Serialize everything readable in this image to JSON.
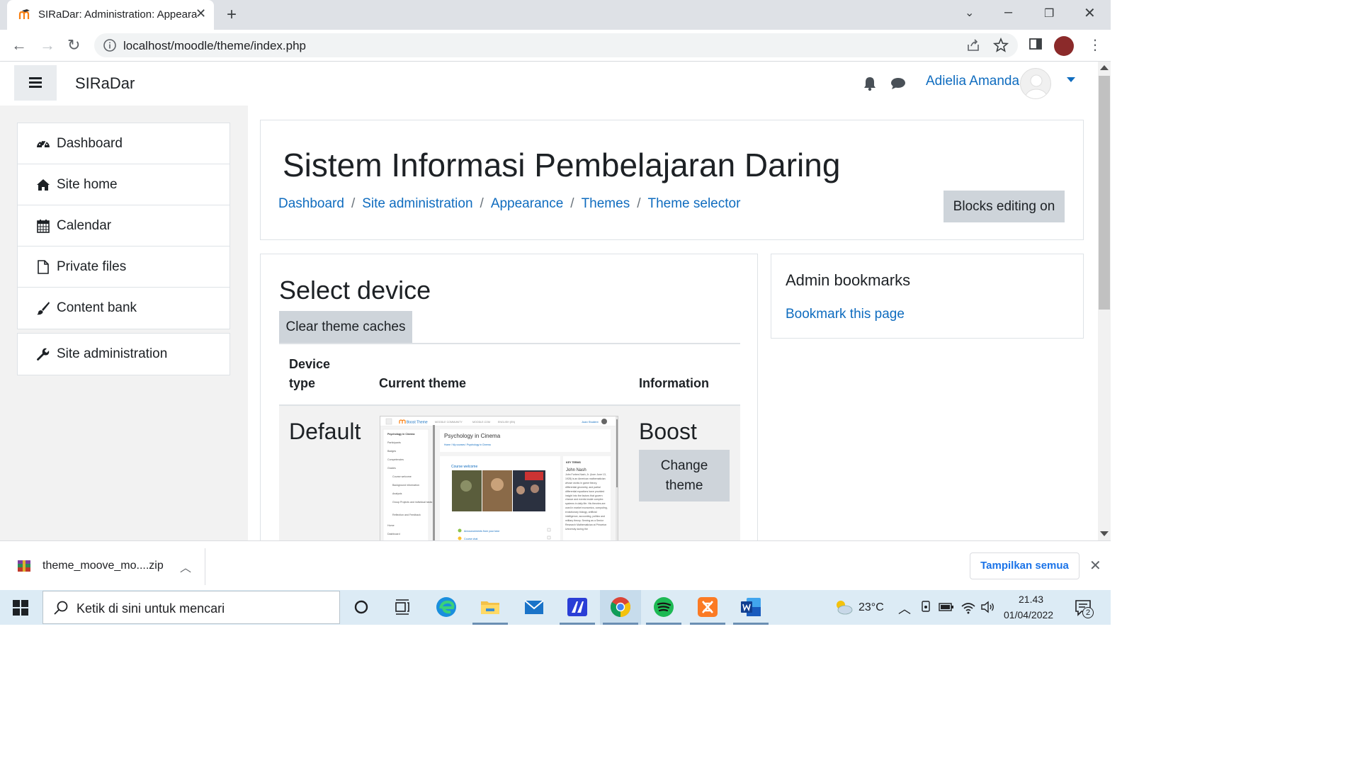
{
  "browser": {
    "tab_title": "SIRaDar: Administration: Appeara",
    "url": "localhost/moodle/theme/index.php"
  },
  "navbar": {
    "brand": "SIRaDar",
    "username": "Adielia Amanda"
  },
  "drawer": {
    "items": [
      {
        "label": "Dashboard",
        "icon": "dashboard-icon"
      },
      {
        "label": "Site home",
        "icon": "home-icon"
      },
      {
        "label": "Calendar",
        "icon": "calendar-icon"
      },
      {
        "label": "Private files",
        "icon": "file-icon"
      },
      {
        "label": "Content bank",
        "icon": "brush-icon"
      }
    ],
    "admin_item": {
      "label": "Site administration",
      "icon": "wrench-icon"
    }
  },
  "header": {
    "title": "Sistem Informasi Pembelajaran Daring",
    "breadcrumb": [
      "Dashboard",
      "Site administration",
      "Appearance",
      "Themes",
      "Theme selector"
    ],
    "blocks_button": "Blocks editing on"
  },
  "theme_selector": {
    "heading": "Select device",
    "clear_button": "Clear theme caches",
    "columns": {
      "device_type_1": "Device",
      "device_type_2": "type",
      "current_theme": "Current theme",
      "information": "Information"
    },
    "row": {
      "device": "Default",
      "theme": "Boost",
      "change_button_1": "Change",
      "change_button_2": "theme"
    },
    "preview": {
      "brand": "Boost Theme",
      "nav_items": [
        "MOODLE COMMUNITY",
        "MOODLE.COM",
        "ENGLISH (EN)"
      ],
      "user": "Joan Student",
      "course_title": "Psychology in Cinema",
      "breadcrumb": "Home / My courses / Psychology in Cinema",
      "sidebar_items": [
        "Psychology in Cinema",
        "Participants",
        "Badges",
        "Competencies",
        "Grades",
        "Course welcome",
        "Background information",
        "Analysis",
        "Group Projects and individual tasks",
        "Reflection and Feedback",
        "Home",
        "Dashboard"
      ],
      "section_title": "Course welcome",
      "key_terms": "KEY TERMS",
      "person": "John Nash",
      "bio": "John Forbes Nash, Jr. (born June 13, 1928) is an American mathematician whose works in game theory, differential geometry, and partial differential equations have provided insight into the factors that govern chance and events inside complex systems in daily life. His theories are used in market economics, computing, evolutionary biology, artificial intelligence, accounting, politics and military theory. Serving as a Senior Research Mathematician at Princeton University during the",
      "activity_1": "Announcements from your tutor",
      "activity_2": "Course chat"
    }
  },
  "admin_bookmarks": {
    "title": "Admin bookmarks",
    "link": "Bookmark this page"
  },
  "download_bar": {
    "filename": "theme_moove_mo....zip",
    "show_all": "Tampilkan semua"
  },
  "taskbar": {
    "search_placeholder": "Ketik di sini untuk mencari",
    "temperature": "23°C",
    "time": "21.43",
    "date": "01/04/2022",
    "notifications": "2"
  },
  "colors": {
    "link": "#0f6cbf",
    "button_grey": "#ced4da",
    "drawer_bg": "#f2f2f2"
  }
}
